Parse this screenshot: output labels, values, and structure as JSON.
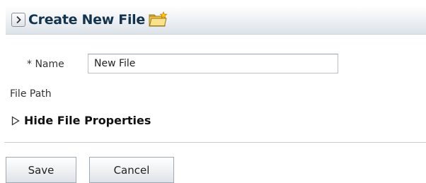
{
  "header": {
    "title": "Create New File",
    "toggle_icon": "chevron-right-icon",
    "title_icon": "new-folder-icon"
  },
  "form": {
    "name_label": "* Name",
    "name_value": "New File",
    "file_path_label": "File Path"
  },
  "disclosure": {
    "label": "Hide File Properties",
    "icon": "triangle-right-icon"
  },
  "buttons": {
    "save_label": "Save",
    "cancel_label": "Cancel"
  },
  "colors": {
    "title_text": "#13344c",
    "header_gradient_top": "#ffffff",
    "header_gradient_bottom": "#dde3ea",
    "folder_icon": "#f2c64a"
  }
}
